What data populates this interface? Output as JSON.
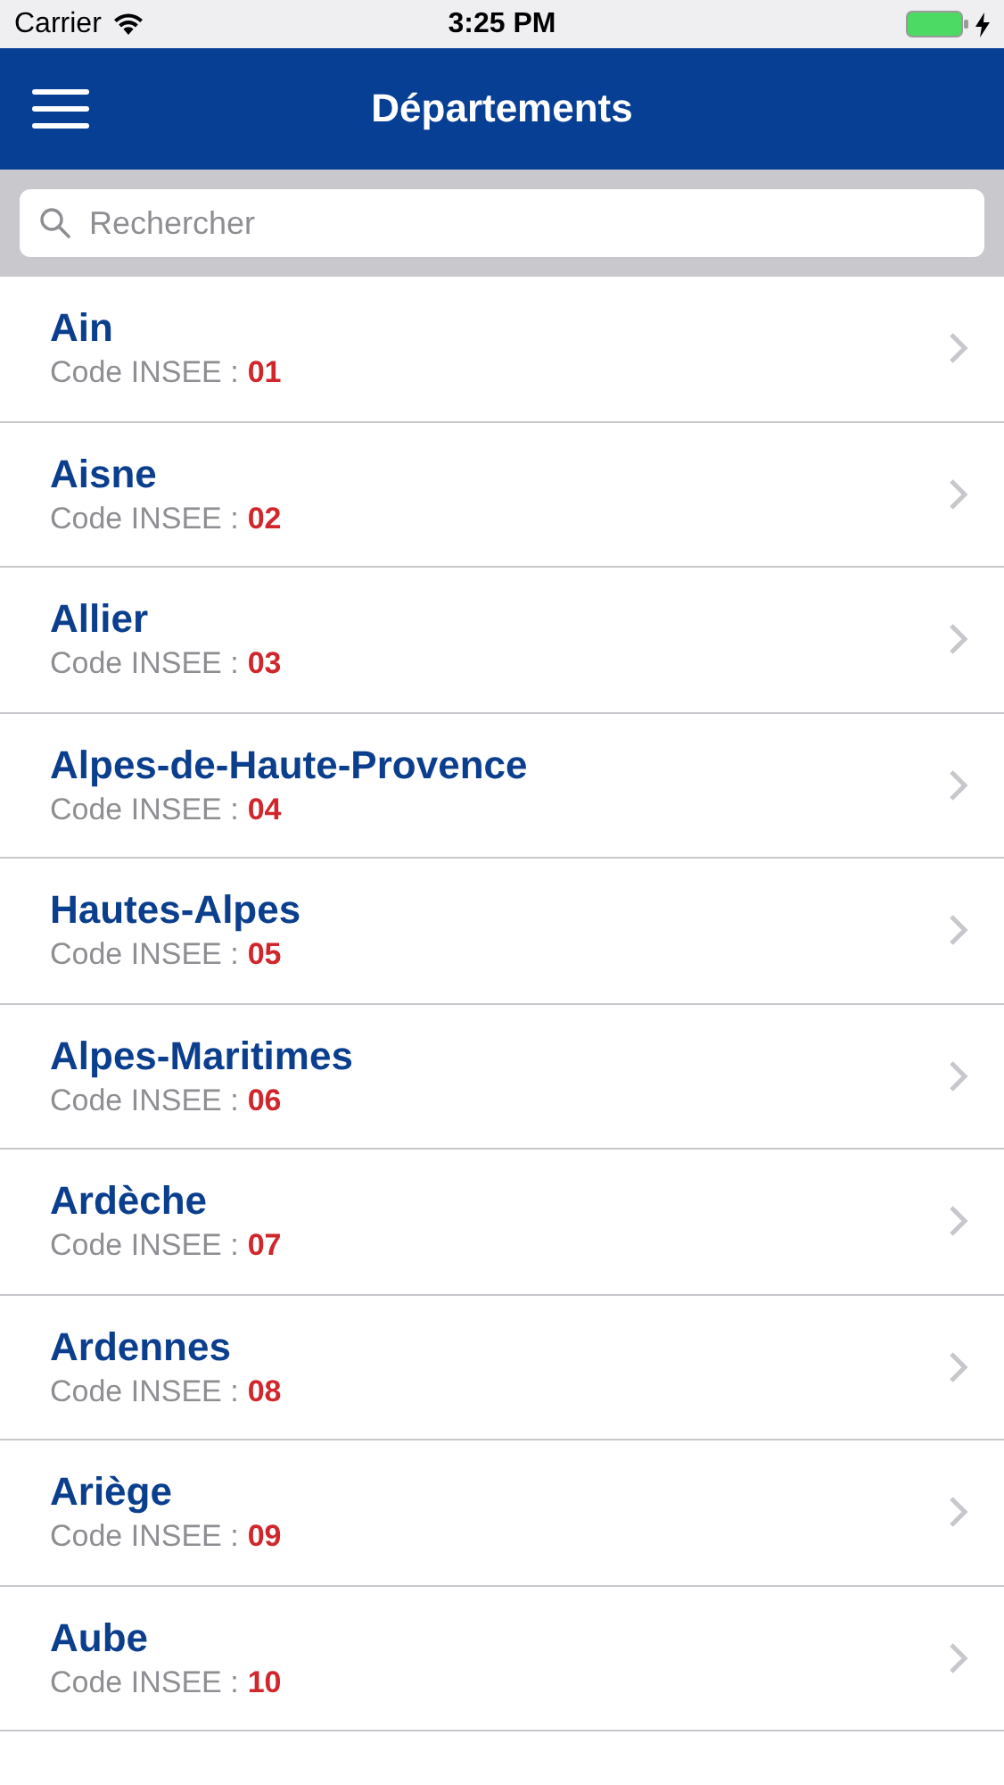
{
  "status_bar": {
    "carrier": "Carrier",
    "time": "3:25 PM"
  },
  "nav_bar": {
    "title": "Départements"
  },
  "search": {
    "placeholder": "Rechercher"
  },
  "departments": [
    {
      "name": "Ain",
      "code_label": "Code INSEE :",
      "code": "01"
    },
    {
      "name": "Aisne",
      "code_label": "Code INSEE :",
      "code": "02"
    },
    {
      "name": "Allier",
      "code_label": "Code INSEE :",
      "code": "03"
    },
    {
      "name": "Alpes-de-Haute-Provence",
      "code_label": "Code INSEE :",
      "code": "04"
    },
    {
      "name": "Hautes-Alpes",
      "code_label": "Code INSEE :",
      "code": "05"
    },
    {
      "name": "Alpes-Maritimes",
      "code_label": "Code INSEE :",
      "code": "06"
    },
    {
      "name": "Ardèche",
      "code_label": "Code INSEE :",
      "code": "07"
    },
    {
      "name": "Ardennes",
      "code_label": "Code INSEE :",
      "code": "08"
    },
    {
      "name": "Ariège",
      "code_label": "Code INSEE :",
      "code": "09"
    },
    {
      "name": "Aube",
      "code_label": "Code INSEE :",
      "code": "10"
    }
  ]
}
